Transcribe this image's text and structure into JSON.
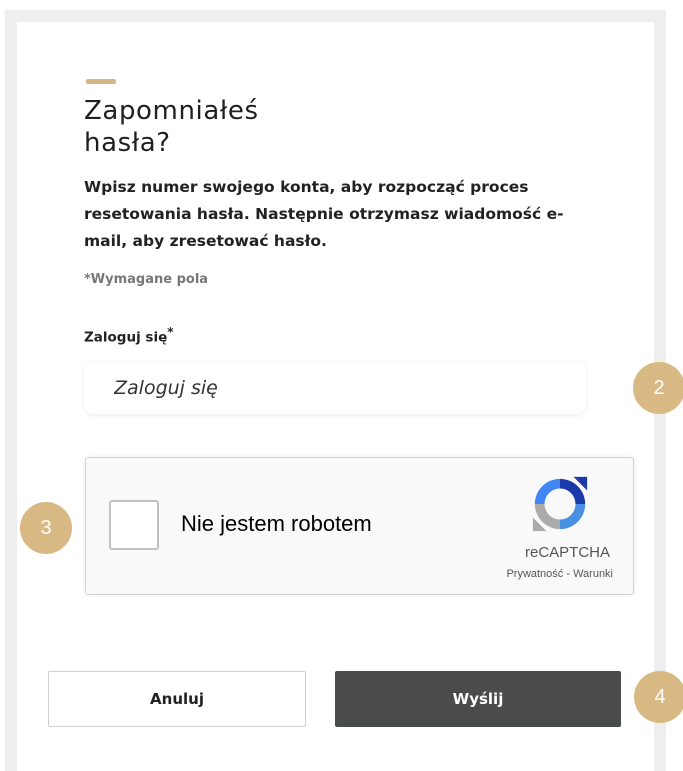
{
  "form": {
    "title_line1": "Zapomniałeś",
    "title_line2": "hasła?",
    "description": "Wpisz numer swojego konta, aby rozpocząć proces resetowania hasła. Następnie otrzymasz wiadomość e-mail, aby zresetować hasło.",
    "required_note": "*Wymagane pola",
    "login_label": "Zaloguj się",
    "login_required_mark": "*",
    "login_placeholder": "Zaloguj się",
    "login_value": ""
  },
  "captcha": {
    "label": "Nie jestem robotem",
    "brand": "reCAPTCHA",
    "terms": "Prywatność - Warunki",
    "checked": false
  },
  "buttons": {
    "cancel": "Anuluj",
    "submit": "Wyślij"
  },
  "badges": {
    "b2": "2",
    "b3": "3",
    "b4": "4",
    "color": "#d8b983"
  },
  "colors": {
    "accent": "#d3b784",
    "submit_bg": "#4a4c4c"
  }
}
